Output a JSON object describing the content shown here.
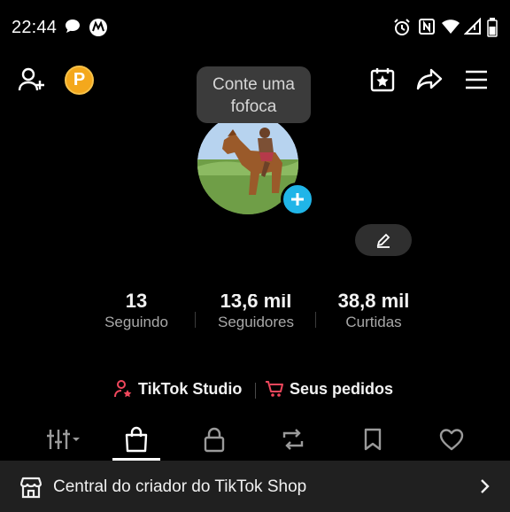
{
  "status_bar": {
    "time": "22:44"
  },
  "tooltip": {
    "line1": "Conte uma",
    "line2": "fofoca"
  },
  "coin": {
    "label": "P"
  },
  "stats": [
    {
      "value": "13",
      "label": "Seguindo"
    },
    {
      "value": "13,6 mil",
      "label": "Seguidores"
    },
    {
      "value": "38,8 mil",
      "label": "Curtidas"
    }
  ],
  "links": {
    "studio": "TikTok Studio",
    "orders": "Seus pedidos"
  },
  "banner": {
    "text": "Central do criador do TikTok Shop"
  },
  "colors": {
    "accent_blue": "#20b5e8",
    "accent_red": "#e0264a",
    "coin": "#f4a81c"
  }
}
